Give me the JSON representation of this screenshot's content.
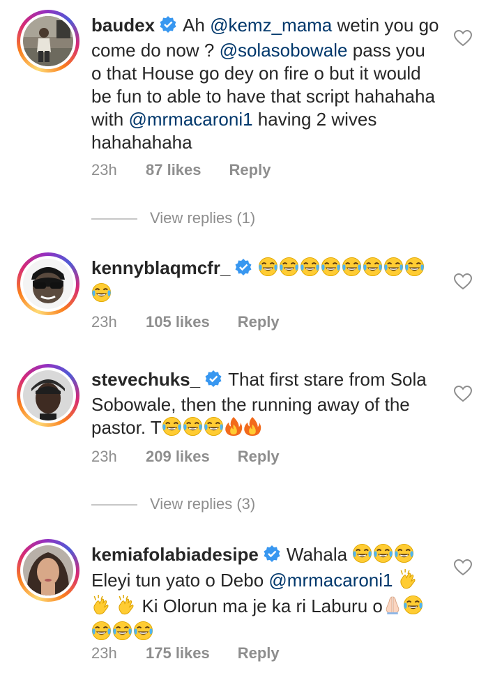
{
  "colors": {
    "text": "#262626",
    "secondary": "#8e8e8e",
    "mention": "#00376b",
    "verified": "#3897f0"
  },
  "comments": [
    {
      "username": "baudex",
      "verified": true,
      "parts": [
        {
          "t": "Ah "
        },
        {
          "m": "@kemz_mama"
        },
        {
          "t": " wetin you go come do now ? "
        },
        {
          "m": "@solasobowale"
        },
        {
          "t": " pass you o that House go dey on fire o but it would be fun to able to have that script hahahaha with "
        },
        {
          "m": "@mrmacaroni1"
        },
        {
          "t": " having 2 wives hahahahaha"
        }
      ],
      "time": "23h",
      "likes": "87 likes",
      "reply": "Reply",
      "view_replies": "View replies (1)",
      "avatar_icon": "photo-avatar"
    },
    {
      "username": "kennyblaqmcfr_",
      "verified": true,
      "parts": [
        {
          "e": "joy"
        },
        {
          "e": "joy"
        },
        {
          "e": "joy"
        },
        {
          "e": "joy"
        },
        {
          "e": "joy"
        },
        {
          "e": "joy"
        },
        {
          "e": "joy"
        },
        {
          "e": "joy"
        },
        {
          "e": "joy"
        }
      ],
      "time": "23h",
      "likes": "105 likes",
      "reply": "Reply",
      "avatar_icon": "cartoon-avatar"
    },
    {
      "username": "stevechuks_",
      "verified": true,
      "parts": [
        {
          "t": "That first stare from Sola Sobowale, then the running away of the pastor. T"
        },
        {
          "e": "joy"
        },
        {
          "e": "joy"
        },
        {
          "e": "joy"
        },
        {
          "e": "fire"
        },
        {
          "e": "fire"
        }
      ],
      "time": "23h",
      "likes": "209 likes",
      "reply": "Reply",
      "view_replies": "View replies (3)",
      "avatar_icon": "photo-avatar"
    },
    {
      "username": "kemiafolabiadesipe",
      "verified": true,
      "parts": [
        {
          "t": "Wahala "
        },
        {
          "e": "joy"
        },
        {
          "e": "joy"
        },
        {
          "e": "joy"
        },
        {
          "t": " Eleyi tun yato o Debo "
        },
        {
          "m": "@mrmacaroni1"
        },
        {
          "t": " "
        },
        {
          "e": "clap"
        },
        {
          "t": " "
        },
        {
          "e": "clap"
        },
        {
          "t": " "
        },
        {
          "e": "clap"
        },
        {
          "t": " Ki Olorun ma je ka ri Laburu o"
        },
        {
          "e": "pray"
        },
        {
          "e": "joy"
        },
        {
          "e": "joy"
        },
        {
          "e": "joy"
        },
        {
          "e": "joy"
        }
      ],
      "time": "23h",
      "likes": "175 likes",
      "reply": "Reply",
      "avatar_icon": "photo-avatar"
    }
  ]
}
